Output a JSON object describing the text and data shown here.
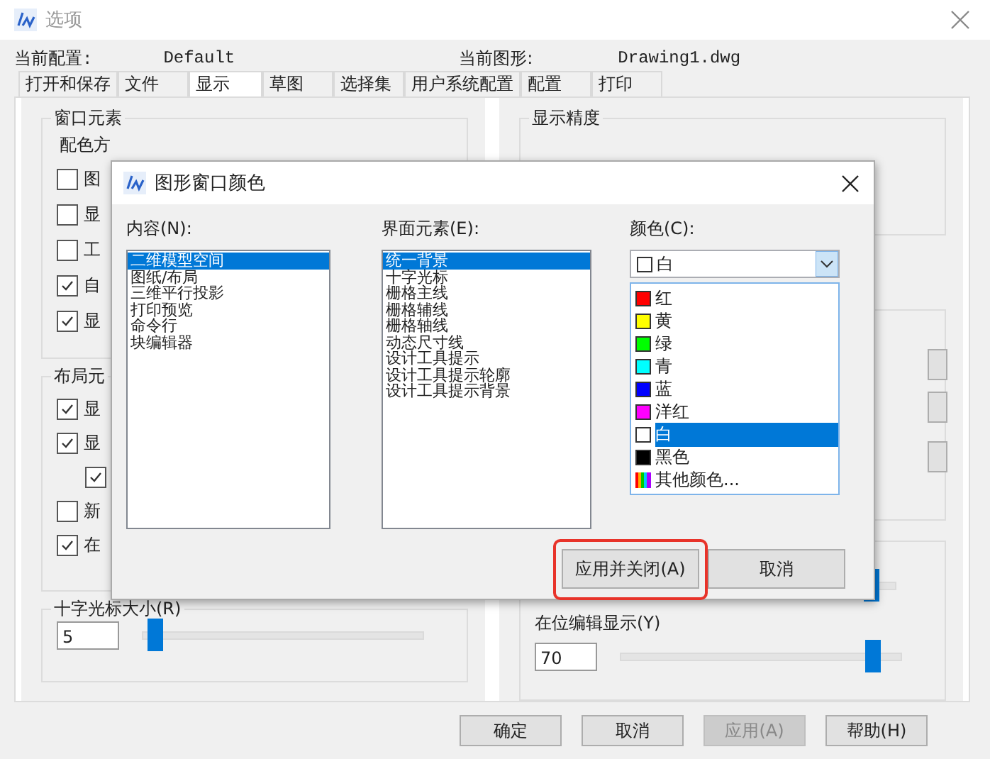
{
  "window": {
    "title": "选项"
  },
  "config": {
    "label": "当前配置:",
    "value": "Default"
  },
  "drawing": {
    "label": "当前图形:",
    "value": "Drawing1.dwg"
  },
  "tabs": [
    {
      "label": "打开和保存",
      "selected": false
    },
    {
      "label": "文件",
      "selected": false
    },
    {
      "label": "显示",
      "selected": true
    },
    {
      "label": "草图",
      "selected": false
    },
    {
      "label": "选择集",
      "selected": false
    },
    {
      "label": "用户系统配置",
      "selected": false
    },
    {
      "label": "配置",
      "selected": false
    },
    {
      "label": "打印",
      "selected": false
    }
  ],
  "window_elements": {
    "title": "窗口元素",
    "scheme_label": "配色方",
    "checkboxes": [
      {
        "label": "图",
        "checked": false
      },
      {
        "label": "显",
        "checked": false
      },
      {
        "label": "工",
        "checked": false
      },
      {
        "label": "自",
        "checked": true
      },
      {
        "label": "显",
        "checked": true
      }
    ]
  },
  "layout_elements": {
    "title": "布局元",
    "checkboxes": [
      {
        "label": "显",
        "checked": true,
        "nested": false
      },
      {
        "label": "显",
        "checked": true,
        "nested": false
      },
      {
        "checked": true,
        "nested": true
      },
      {
        "label": "新",
        "checked": false,
        "nested": false
      },
      {
        "label": "在",
        "checked": true,
        "nested": false
      }
    ]
  },
  "crosshair": {
    "title": "十字光标大小(R)",
    "value": "5",
    "level": 0.04
  },
  "display_precision": {
    "title": "显示精度"
  },
  "fade_slider": {
    "level": 0.9
  },
  "inplace_edit": {
    "title": "在位编辑显示(Y)",
    "value": "70",
    "level": 0.9
  },
  "buttons": [
    {
      "label": "确定",
      "disabled": false
    },
    {
      "label": "取消",
      "disabled": false
    },
    {
      "label": "应用(A)",
      "disabled": true
    },
    {
      "label": "帮助(H)",
      "disabled": false
    }
  ],
  "dialog": {
    "title": "图形窗口颜色",
    "content_label": "内容(N):",
    "content_items": [
      {
        "label": "二维模型空间",
        "selected": true
      },
      {
        "label": "图纸/布局",
        "selected": false
      },
      {
        "label": "三维平行投影",
        "selected": false
      },
      {
        "label": "打印预览",
        "selected": false
      },
      {
        "label": "命令行",
        "selected": false
      },
      {
        "label": "块编辑器",
        "selected": false
      }
    ],
    "element_label": "界面元素(E):",
    "element_items": [
      {
        "label": "统一背景",
        "selected": true
      },
      {
        "label": "十字光标",
        "selected": false
      },
      {
        "label": "栅格主线",
        "selected": false
      },
      {
        "label": "栅格辅线",
        "selected": false
      },
      {
        "label": "栅格轴线",
        "selected": false
      },
      {
        "label": "动态尺寸线",
        "selected": false
      },
      {
        "label": "设计工具提示",
        "selected": false
      },
      {
        "label": "设计工具提示轮廓",
        "selected": false
      },
      {
        "label": "设计工具提示背景",
        "selected": false
      }
    ],
    "color_label": "颜色(C):",
    "color_value": {
      "label": "白",
      "color": "#ffffff"
    },
    "color_options": [
      {
        "kind": "color",
        "label": "红",
        "color": "#ff0000",
        "selected": false
      },
      {
        "kind": "color",
        "label": "黄",
        "color": "#ffff00",
        "selected": false
      },
      {
        "kind": "color",
        "label": "绿",
        "color": "#00ff00",
        "selected": false
      },
      {
        "kind": "color",
        "label": "青",
        "color": "#00ffff",
        "selected": false
      },
      {
        "kind": "color",
        "label": "蓝",
        "color": "#0000ff",
        "selected": false
      },
      {
        "kind": "color",
        "label": "洋红",
        "color": "#ff00ff",
        "selected": false
      },
      {
        "kind": "color",
        "label": "白",
        "color": "#ffffff",
        "selected": true
      },
      {
        "kind": "color",
        "label": "黑色",
        "color": "#000000",
        "selected": false
      },
      {
        "kind": "more",
        "label": "其他颜色..."
      }
    ],
    "buttons": [
      {
        "label": "应用并关闭(A)",
        "highlighted": true
      },
      {
        "label": "取消",
        "highlighted": false
      }
    ]
  }
}
